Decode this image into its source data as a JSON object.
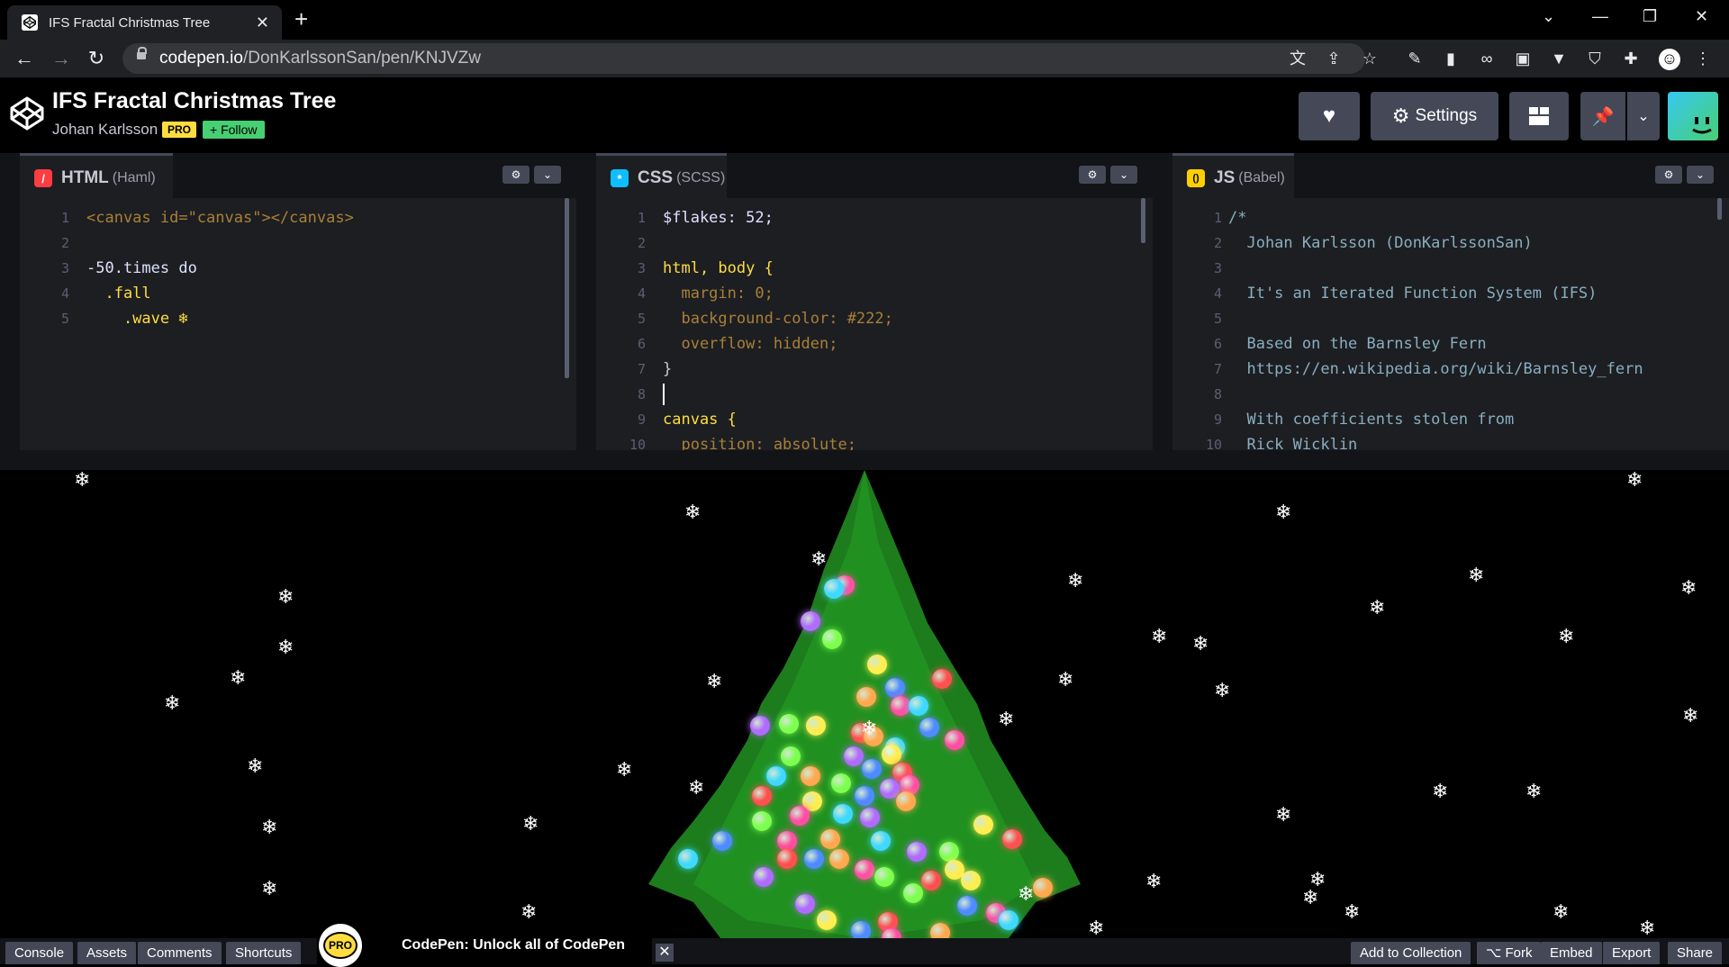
{
  "browser": {
    "tab_title": "IFS Fractal Christmas Tree",
    "tab_close": "✕",
    "new_tab": "+",
    "url_host": "codepen.io",
    "url_path": "/DonKarlssonSan/pen/KNJVZw"
  },
  "pen": {
    "title": "IFS Fractal Christmas Tree",
    "author": "Johan Karlsson",
    "pro_badge": "PRO",
    "follow_label": "+ Follow",
    "settings_label": "Settings"
  },
  "editors": {
    "html": {
      "lang": "HTML",
      "processor": "(Haml)",
      "icon": "/",
      "lines": [
        {
          "n": "1",
          "t": "<canvas id=\"canvas\"></canvas>"
        },
        {
          "n": "2",
          "t": ""
        },
        {
          "n": "3",
          "t": "-50.times do"
        },
        {
          "n": "4",
          "t": "  .fall"
        },
        {
          "n": "5",
          "t": "    .wave ❄"
        }
      ]
    },
    "css": {
      "lang": "CSS",
      "processor": "(SCSS)",
      "icon": "*",
      "lines": [
        {
          "n": "1",
          "t": "$flakes: 52;"
        },
        {
          "n": "2",
          "t": ""
        },
        {
          "n": "3",
          "t": "html, body {"
        },
        {
          "n": "4",
          "t": "  margin: 0;"
        },
        {
          "n": "5",
          "t": "  background-color: #222;"
        },
        {
          "n": "6",
          "t": "  overflow: hidden;"
        },
        {
          "n": "7",
          "t": "}"
        },
        {
          "n": "8",
          "t": ""
        },
        {
          "n": "9",
          "t": "canvas {"
        },
        {
          "n": "10",
          "t": "  position: absolute;"
        }
      ]
    },
    "js": {
      "lang": "JS",
      "processor": "(Babel)",
      "icon": "()",
      "lines": [
        {
          "n": "1",
          "t": "/*"
        },
        {
          "n": "2",
          "t": "  Johan Karlsson (DonKarlssonSan)"
        },
        {
          "n": "3",
          "t": ""
        },
        {
          "n": "4",
          "t": "  It's an Iterated Function System (IFS)"
        },
        {
          "n": "5",
          "t": ""
        },
        {
          "n": "6",
          "t": "  Based on the Barnsley Fern"
        },
        {
          "n": "7",
          "t": "  https://en.wikipedia.org/wiki/Barnsley_fern"
        },
        {
          "n": "8",
          "t": ""
        },
        {
          "n": "9",
          "t": "  With coefficients stolen from"
        },
        {
          "n": "10",
          "t": "  Rick Wicklin"
        }
      ]
    }
  },
  "footer": {
    "left_buttons": [
      "Console",
      "Assets",
      "Comments",
      "Shortcuts"
    ],
    "promo_badge": "PRO",
    "promo_text": "CodePen: Unlock all of CodePen",
    "promo_close": "✕",
    "right_buttons": [
      "Add to Collection",
      "⌥ Fork",
      "Embed",
      "Export",
      "Share"
    ]
  },
  "colors": {
    "html_icon": "#ff3c41",
    "css_icon": "#0ebeff",
    "js_icon": "#fcd000",
    "pro": "#ffdd40",
    "follow": "#47cf73",
    "tree": "#1f8a1f"
  }
}
